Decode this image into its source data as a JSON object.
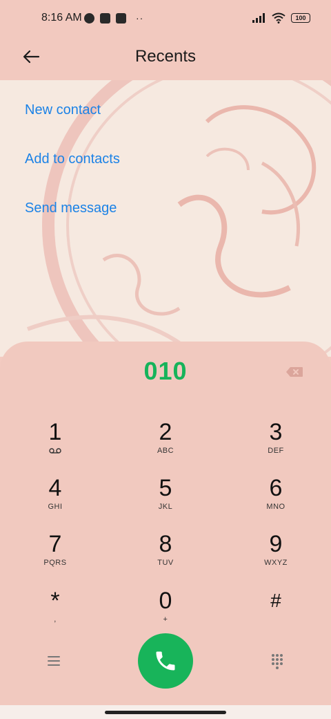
{
  "status_bar": {
    "time": "8:16 AM",
    "battery": "100",
    "icons": [
      "weather-icon",
      "app-square-icon",
      "upload-icon",
      "more-dots-icon",
      "signal-icon",
      "wifi-icon",
      "battery-icon"
    ]
  },
  "header": {
    "title": "Recents",
    "back_icon": "arrow-left-icon"
  },
  "actions": [
    {
      "label": "New contact"
    },
    {
      "label": "Add to contacts"
    },
    {
      "label": "Send message"
    }
  ],
  "dialer": {
    "number": "010",
    "keys": [
      {
        "digit": "1",
        "letters": ""
      },
      {
        "digit": "2",
        "letters": "ABC"
      },
      {
        "digit": "3",
        "letters": "DEF"
      },
      {
        "digit": "4",
        "letters": "GHI"
      },
      {
        "digit": "5",
        "letters": "JKL"
      },
      {
        "digit": "6",
        "letters": "MNO"
      },
      {
        "digit": "7",
        "letters": "PQRS"
      },
      {
        "digit": "8",
        "letters": "TUV"
      },
      {
        "digit": "9",
        "letters": "WXYZ"
      },
      {
        "digit": "*",
        "letters": ","
      },
      {
        "digit": "0",
        "letters": "+"
      },
      {
        "digit": "#",
        "letters": ""
      }
    ]
  },
  "colors": {
    "accent_blue": "#1b82e6",
    "call_green": "#18b45a",
    "number_green": "#16b35a",
    "panel": "#f1c9bf"
  }
}
